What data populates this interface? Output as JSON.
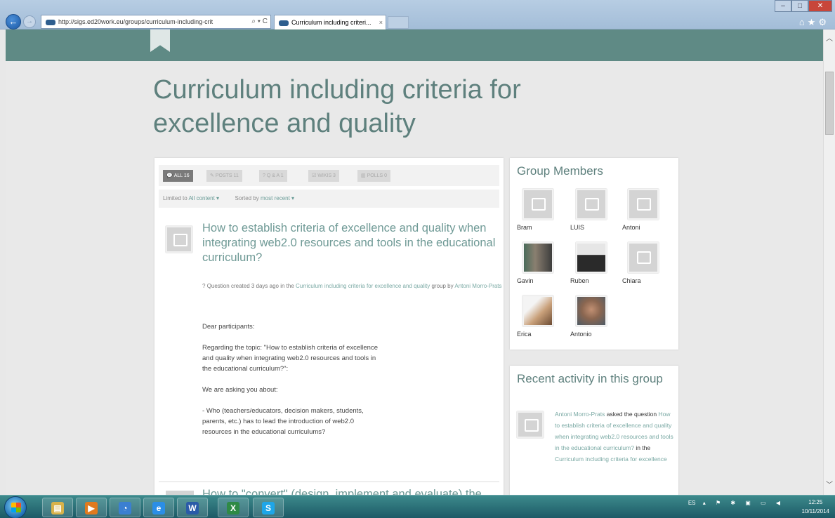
{
  "browser": {
    "url": "http://sigs.ed20work.eu/groups/curriculum-including-crit",
    "tab_title": "Curriculum including criteri...",
    "tab_close": "×",
    "back": "←",
    "forward": "→",
    "addr_controls": "⌕ ▾ C",
    "min": "–",
    "max": "□",
    "close": "✕",
    "toolbar_icons": "⌂★⚙"
  },
  "page": {
    "title": "Curriculum including criteria for excellence and quality"
  },
  "filter_tabs": [
    {
      "icon": "speech-bubble",
      "label": "ALL 16",
      "active": true
    },
    {
      "icon": "pencil",
      "label": "POSTS 11"
    },
    {
      "icon": "question",
      "label": "Q & A 1"
    },
    {
      "icon": "checkbox",
      "label": "WIKIS 3"
    },
    {
      "icon": "bar-chart",
      "label": "POLLS 0"
    }
  ],
  "filters": {
    "limited_prefix": "Limited to",
    "limited_value": "All content ▾",
    "sorted_prefix": "Sorted by",
    "sorted_value": "most recent ▾"
  },
  "post": {
    "title": "How to establish criteria of excellence and quality when integrating web2.0 resources and tools in the educational curriculum?",
    "type": "Question",
    "meta_created": "created 3 days ago in the",
    "group_link": "Curriculum including criteria for excellence and quality",
    "meta_by": "group by",
    "author": "Antoni Morro-Prats",
    "body": [
      "Dear participants:",
      "Regarding the topic: \"How to establish criteria of excellence\nand quality when integrating web2.0 resources and tools in\nthe educational curriculum?\":",
      "We are asking you about:",
      "- Who (teachers/educators, decision makers, students,\nparents, etc.) has to lead the introduction of web2.0\nresources in the educational curriculums?"
    ]
  },
  "next_post": {
    "title": "How to \"convert\" (design, implement and evaluate) the"
  },
  "members": {
    "title": "Group Members",
    "list": [
      "Bram",
      "LUIS",
      "Antoni",
      "Gavin",
      "Ruben",
      "Chiara",
      "Erica",
      "Antonio"
    ]
  },
  "activity": {
    "title": "Recent activity in this group",
    "actor": "Antoni Morro-Prats",
    "verb": "asked the question",
    "question": "How to establish criteria of excellence and quality when integrating web2.0 resources and tools in the educational curriculum?",
    "in_the": "in the",
    "group": "Curriculum including criteria for excellence"
  },
  "taskbar": {
    "language": "ES",
    "time": "12:25",
    "date": "10/11/2014",
    "tray_icons": "▴ ⚑ ✱ ▣ ▭ ◀",
    "apps": [
      {
        "name": "explorer",
        "glyph": "▤",
        "color": "#d9b24a"
      },
      {
        "name": "media-player",
        "glyph": "▶",
        "color": "#e07a1f"
      },
      {
        "name": "browser-alt",
        "glyph": "◔",
        "color": "#3b7fd1"
      },
      {
        "name": "internet-explorer",
        "glyph": "e",
        "color": "#2b8ee6"
      },
      {
        "name": "word",
        "glyph": "W",
        "color": "#2a5ba8"
      },
      {
        "name": "excel",
        "glyph": "X",
        "color": "#2f8a45"
      },
      {
        "name": "skype",
        "glyph": "S",
        "color": "#1ea6e8"
      }
    ]
  }
}
